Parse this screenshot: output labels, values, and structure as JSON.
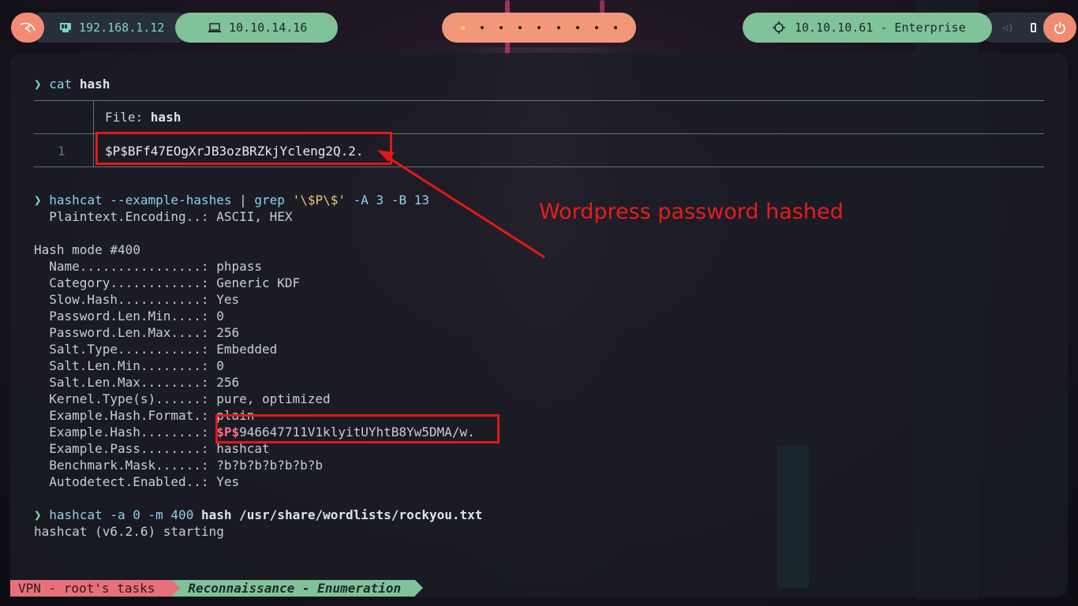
{
  "topbar": {
    "local_ip": "192.168.1.12",
    "vpn_ip": "10.10.14.16",
    "target": "10.10.10.61 - Enterprise"
  },
  "terminal": {
    "prompt_symbol": "❯",
    "cmd1": {
      "program": "cat",
      "arg": "hash"
    },
    "bat": {
      "header_label": "File: ",
      "header_file": "hash",
      "line_number": "1",
      "content": "$P$BFf47EOgXrJB3ozBRZkjYcleng2Q.2."
    },
    "cmd2": {
      "program": "hashcat",
      "flags": "--example-hashes",
      "pipe": "|",
      "grep": "grep",
      "pattern": "'\\$P\\$'",
      "rest": "-A 3 -B 13"
    },
    "output_lines": [
      "  Plaintext.Encoding..: ASCII, HEX",
      "",
      "Hash mode #400",
      "  Name................: phpass",
      "  Category............: Generic KDF",
      "  Slow.Hash...........: Yes",
      "  Password.Len.Min....: 0",
      "  Password.Len.Max....: 256",
      "  Salt.Type...........: Embedded",
      "  Salt.Len.Min........: 0",
      "  Salt.Len.Max........: 256",
      "  Kernel.Type(s)......: pure, optimized",
      "  Example.Hash.Format.: plain"
    ],
    "example_hash_label": "  Example.Hash........: ",
    "example_hash_prefix": "$P$",
    "example_hash_rest": "946647711V1klyitUYhtB8Yw5DMA/w.",
    "output_tail": [
      "  Example.Pass........: hashcat",
      "  Benchmark.Mask......: ?b?b?b?b?b?b?b",
      "  Autodetect.Enabled..: Yes"
    ],
    "cmd3": {
      "program": "hashcat",
      "flags": "-a 0 -m 400",
      "file": "hash",
      "wordlist": "/usr/share/wordlists/rockyou.txt"
    },
    "cmd3_output": "hashcat (v6.2.6) starting"
  },
  "annotation": "Wordpress password hashed",
  "statusbar": {
    "session": "VPN - root's tasks",
    "window": "Reconnaissance - Enumeration"
  },
  "colors": {
    "accent_green": "#80c29a",
    "accent_salmon": "#f28b74",
    "annotation_red": "#e01818"
  }
}
